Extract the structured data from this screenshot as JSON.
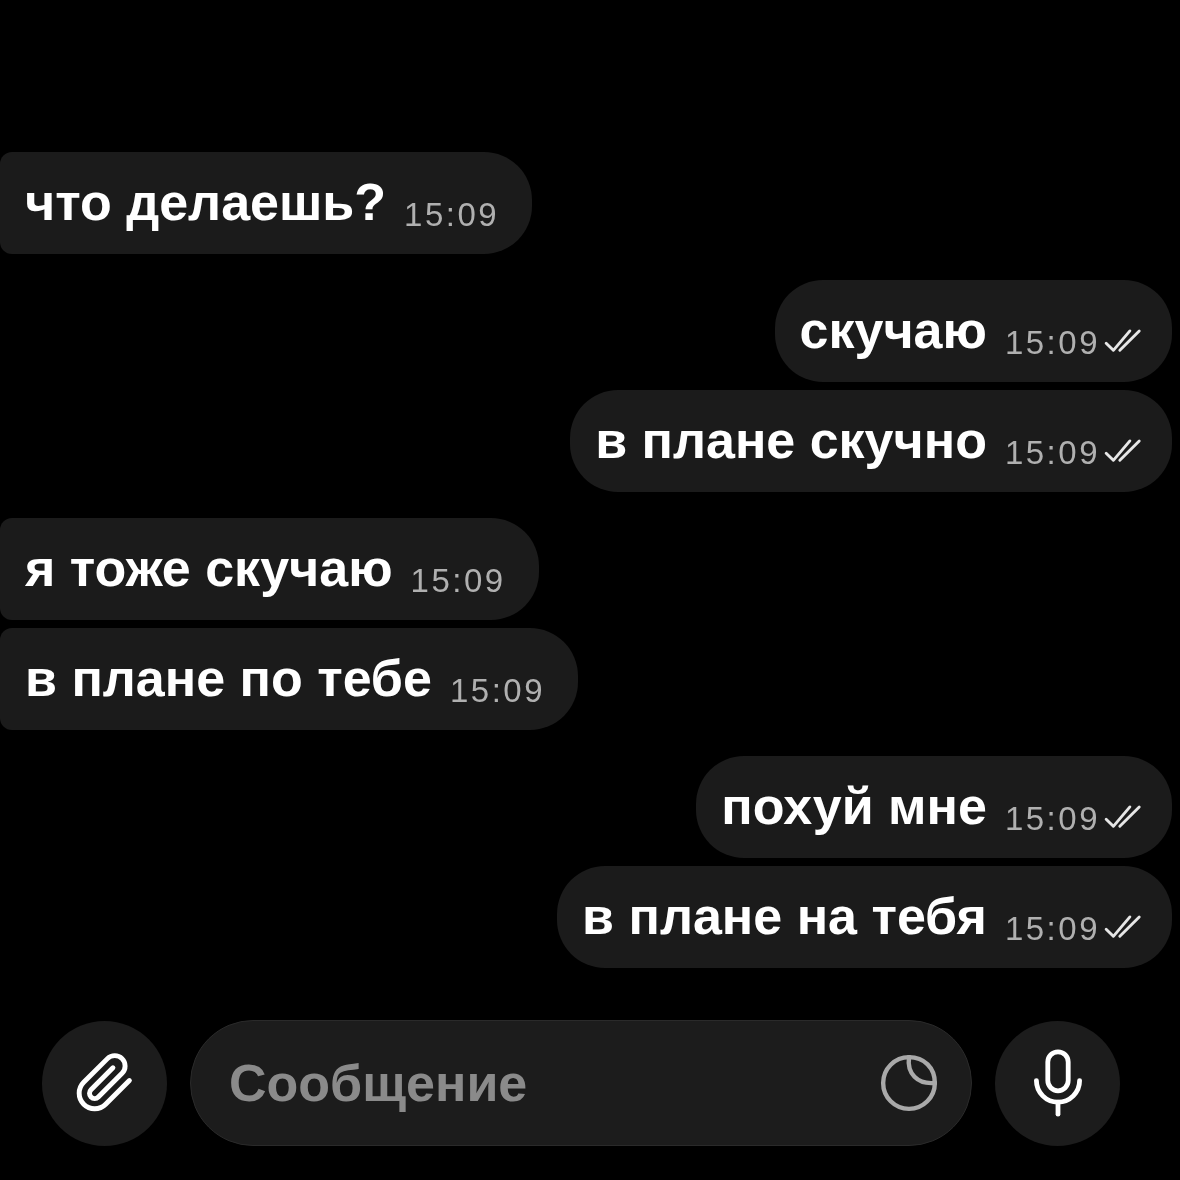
{
  "messages": [
    {
      "kind": "incoming",
      "text": "что делаешь?",
      "time": "15:09"
    },
    {
      "kind": "outgoing",
      "text": "скучаю",
      "time": "15:09",
      "read": true
    },
    {
      "kind": "outgoing",
      "text": "в плане скучно",
      "time": "15:09",
      "read": true
    },
    {
      "kind": "incoming",
      "text": "я тоже скучаю",
      "time": "15:09"
    },
    {
      "kind": "incoming",
      "text": "в плане по тебе",
      "time": "15:09"
    },
    {
      "kind": "outgoing",
      "text": "похуй мне",
      "time": "15:09",
      "read": true
    },
    {
      "kind": "outgoing",
      "text": "в плане на тебя",
      "time": "15:09",
      "read": true
    }
  ],
  "composer": {
    "placeholder": "Сообщение"
  }
}
